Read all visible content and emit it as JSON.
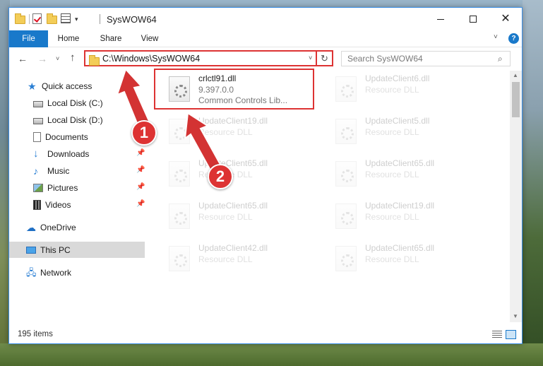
{
  "window": {
    "title": "SysWOW64",
    "minimize_glyph": "",
    "close_glyph": "✕"
  },
  "ribbon": {
    "tabs": [
      "File",
      "Home",
      "Share",
      "View"
    ],
    "expand_glyph": "˅",
    "help_glyph": "?"
  },
  "nav": {
    "back_glyph": "←",
    "forward_glyph": "→",
    "recent_glyph": "˅",
    "up_glyph": "↑",
    "address": "C:\\Windows\\SysWOW64",
    "address_dropdown_glyph": "˅",
    "refresh_glyph": "↻",
    "search_placeholder": "Search SysWOW64",
    "search_glyph": "⌕"
  },
  "sidebar": {
    "items": [
      {
        "label": "Quick access",
        "icon": "star-icon",
        "pinned": false
      },
      {
        "label": "Local Disk (C:)",
        "icon": "drive-icon",
        "pinned": false
      },
      {
        "label": "Local Disk (D:)",
        "icon": "drive-icon",
        "pinned": false
      },
      {
        "label": "Documents",
        "icon": "documents-icon",
        "pinned": false
      },
      {
        "label": "Downloads",
        "icon": "downloads-icon",
        "pinned": true
      },
      {
        "label": "Music",
        "icon": "music-icon",
        "pinned": true
      },
      {
        "label": "Pictures",
        "icon": "pictures-icon",
        "pinned": true
      },
      {
        "label": "Videos",
        "icon": "videos-icon",
        "pinned": true
      },
      {
        "label": "OneDrive",
        "icon": "onedrive-icon",
        "pinned": false
      },
      {
        "label": "This PC",
        "icon": "this-pc-icon",
        "pinned": false,
        "selected": true
      },
      {
        "label": "Network",
        "icon": "network-icon",
        "pinned": false
      }
    ]
  },
  "files": [
    {
      "name": "crlctl91.dll",
      "line1": "9.397.0.0",
      "line2": "Common Controls Lib...",
      "faded": false
    },
    {
      "name": "UpdateClient6.dll",
      "line1": "Resource DLL",
      "line2": "",
      "faded": true
    },
    {
      "name": "UpdateClient19.dll",
      "line1": "Resource DLL",
      "line2": "",
      "faded": true
    },
    {
      "name": "UpdateClient5.dll",
      "line1": "Resource DLL",
      "line2": "",
      "faded": true
    },
    {
      "name": "UpdateClient65.dll",
      "line1": "Resource DLL",
      "line2": "",
      "faded": true
    },
    {
      "name": "UpdateClient65.dll",
      "line1": "Resource DLL",
      "line2": "",
      "faded": true
    },
    {
      "name": "UpdateClient65.dll",
      "line1": "Resource DLL",
      "line2": "",
      "faded": true
    },
    {
      "name": "UpdateClient19.dll",
      "line1": "Resource DLL",
      "line2": "",
      "faded": true
    },
    {
      "name": "UpdateClient42.dll",
      "line1": "Resource DLL",
      "line2": "",
      "faded": true
    },
    {
      "name": "UpdateClient65.dll",
      "line1": "Resource DLL",
      "line2": "",
      "faded": true
    }
  ],
  "status": {
    "item_count": "195 items"
  },
  "annotations": {
    "badge1": "1",
    "badge2": "2",
    "color": "#d33333"
  },
  "colors": {
    "accent": "#1979ca",
    "highlight": "#d33333"
  }
}
